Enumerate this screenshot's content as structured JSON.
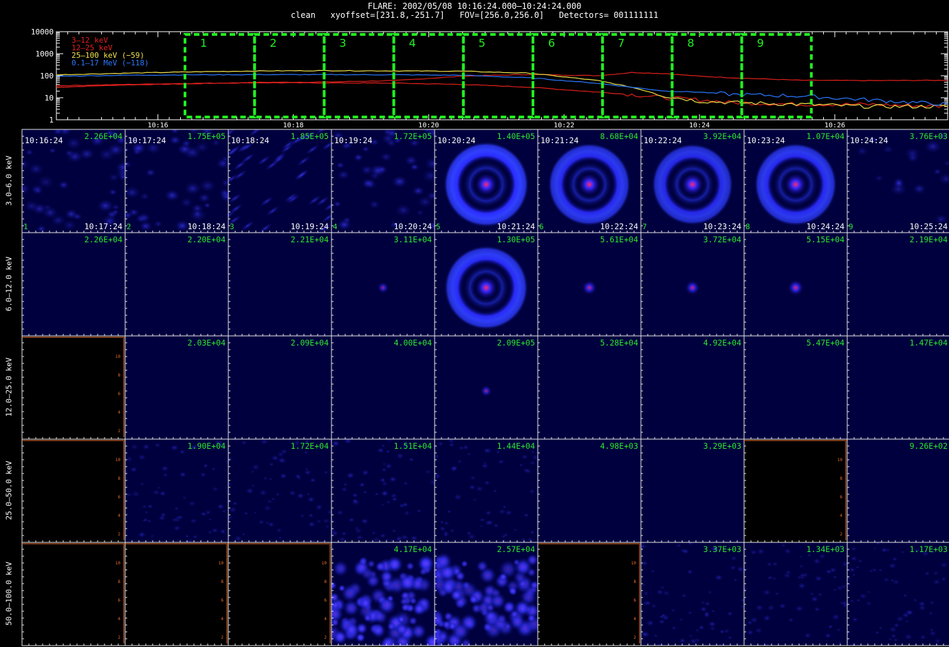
{
  "header": {
    "line1": "FLARE: 2002/05/08 10:16:24.000–10:24:24.000",
    "line2": "clean   xyoffset=[231.8,-251.7]   FOV=[256.0,256.0]   Detectors= 001111111"
  },
  "colors": {
    "band_3_12": "#e0201c",
    "band_12_25": "#e0201c",
    "band_25_100": "#f2e24a",
    "band_100": "#2a78ff",
    "cell_line": "#f07030",
    "value_text": "#2ee82e",
    "window_box": "#22ee22"
  },
  "chart_data": {
    "type": "line",
    "title": "",
    "xlabel": "",
    "ylabel": "",
    "y_scale": "log",
    "ylim": [
      1,
      10000
    ],
    "y_ticks": [
      "1",
      "10",
      "100",
      "1000",
      "10000"
    ],
    "xlim": [
      "10:14:30",
      "10:27:40"
    ],
    "x_ticks": [
      "10:16",
      "10:18",
      "10:20",
      "10:22",
      "10:24",
      "10:26"
    ],
    "legend_position": "top-left",
    "series": [
      {
        "name": "3–12 keV",
        "color": "#e0201c",
        "points": [
          [
            "10:14:30",
            30
          ],
          [
            "10:15:30",
            38
          ],
          [
            "10:16:30",
            43
          ],
          [
            "10:17:30",
            50
          ],
          [
            "10:18:30",
            52
          ],
          [
            "10:19:30",
            60
          ],
          [
            "10:20:30",
            95
          ],
          [
            "10:21:30",
            115
          ],
          [
            "10:22:30",
            100
          ],
          [
            "10:23:00",
            140
          ],
          [
            "10:23:30",
            125
          ],
          [
            "10:24:00",
            95
          ],
          [
            "10:24:30",
            80
          ],
          [
            "10:25:30",
            62
          ],
          [
            "10:26:30",
            60
          ],
          [
            "10:27:40",
            62
          ]
        ]
      },
      {
        "name": "12–25 keV",
        "color": "#e0201c",
        "points": [
          [
            "10:14:30",
            35
          ],
          [
            "10:15:30",
            40
          ],
          [
            "10:16:30",
            45
          ],
          [
            "10:17:30",
            48
          ],
          [
            "10:18:30",
            47
          ],
          [
            "10:19:30",
            46
          ],
          [
            "10:20:30",
            40
          ],
          [
            "10:21:30",
            30
          ],
          [
            "10:22:30",
            18
          ],
          [
            "10:23:00",
            14
          ],
          [
            "10:23:30",
            10
          ],
          [
            "10:24:00",
            8
          ],
          [
            "10:24:30",
            6
          ],
          [
            "10:25:30",
            5
          ],
          [
            "10:26:30",
            5
          ],
          [
            "10:27:40",
            4
          ]
        ]
      },
      {
        "name": "25–100 keV (−59)",
        "color": "#f2e24a",
        "points": [
          [
            "10:14:30",
            110
          ],
          [
            "10:15:30",
            130
          ],
          [
            "10:16:30",
            150
          ],
          [
            "10:17:30",
            165
          ],
          [
            "10:18:30",
            170
          ],
          [
            "10:19:30",
            165
          ],
          [
            "10:20:30",
            160
          ],
          [
            "10:21:30",
            130
          ],
          [
            "10:22:30",
            60
          ],
          [
            "10:23:00",
            30
          ],
          [
            "10:23:30",
            12
          ],
          [
            "10:24:00",
            7
          ],
          [
            "10:24:30",
            6
          ],
          [
            "10:25:30",
            5
          ],
          [
            "10:26:30",
            4
          ],
          [
            "10:27:40",
            4
          ]
        ]
      },
      {
        "name": "0.1–17 MeV (−118)",
        "color": "#2a78ff",
        "points": [
          [
            "10:14:30",
            95
          ],
          [
            "10:15:30",
            105
          ],
          [
            "10:16:30",
            110
          ],
          [
            "10:17:30",
            112
          ],
          [
            "10:18:30",
            112
          ],
          [
            "10:19:30",
            110
          ],
          [
            "10:20:30",
            105
          ],
          [
            "10:21:30",
            80
          ],
          [
            "10:22:30",
            45
          ],
          [
            "10:23:00",
            30
          ],
          [
            "10:23:30",
            20
          ],
          [
            "10:24:00",
            18
          ],
          [
            "10:24:30",
            14
          ],
          [
            "10:25:30",
            12
          ],
          [
            "10:26:30",
            8
          ],
          [
            "10:27:40",
            5
          ]
        ]
      }
    ],
    "windows": [
      {
        "label": "1",
        "start": "10:16:24",
        "end": "10:17:24"
      },
      {
        "label": "2",
        "start": "10:17:24",
        "end": "10:18:24"
      },
      {
        "label": "3",
        "start": "10:18:24",
        "end": "10:19:24"
      },
      {
        "label": "4",
        "start": "10:19:24",
        "end": "10:20:24"
      },
      {
        "label": "5",
        "start": "10:20:24",
        "end": "10:21:24"
      },
      {
        "label": "6",
        "start": "10:21:24",
        "end": "10:22:24"
      },
      {
        "label": "7",
        "start": "10:22:24",
        "end": "10:23:24"
      },
      {
        "label": "8",
        "start": "10:23:24",
        "end": "10:24:24"
      },
      {
        "label": "9",
        "start": "10:24:24",
        "end": "10:25:24"
      }
    ]
  },
  "images": {
    "start_times": [
      "10:16:24",
      "10:17:24",
      "10:18:24",
      "10:19:24",
      "10:20:24",
      "10:21:24",
      "10:22:24",
      "10:23:24",
      "10:24:24"
    ],
    "end_times": [
      "10:17:24",
      "10:18:24",
      "10:19:24",
      "10:20:24",
      "10:21:24",
      "10:22:24",
      "10:23:24",
      "10:24:24",
      "10:25:24"
    ],
    "indices": [
      "1",
      "2",
      "3",
      "4",
      "5",
      "6",
      "7",
      "8",
      "9"
    ],
    "rows": [
      {
        "band": "3.0–6.0 keV",
        "values": [
          "2.26E+04",
          "1.75E+05",
          "1.85E+05",
          "1.72E+05",
          "1.40E+05",
          "8.68E+04",
          "3.92E+04",
          "1.07E+04",
          "3.76E+03"
        ],
        "kind": [
          "noise",
          "blobs",
          "stripes",
          "blobs",
          "ring",
          "ring",
          "ring",
          "ring",
          "faint"
        ],
        "intensity": [
          0.6,
          0.7,
          0.6,
          0.7,
          1.0,
          0.8,
          0.7,
          0.8,
          0.4
        ],
        "empty": [
          false,
          false,
          false,
          false,
          false,
          false,
          false,
          false,
          false
        ]
      },
      {
        "band": "6.0–12.0 keV",
        "values": [
          "2.26E+04",
          "2.20E+04",
          "2.21E+04",
          "3.11E+04",
          "1.30E+05",
          "5.61E+04",
          "3.72E+04",
          "5.15E+04",
          "2.19E+04"
        ],
        "kind": [
          "flat",
          "flat",
          "flat",
          "dot",
          "ring",
          "dot",
          "dot",
          "dot",
          "flat"
        ],
        "intensity": [
          0.1,
          0.1,
          0.1,
          0.4,
          0.9,
          0.7,
          0.7,
          0.8,
          0.1
        ],
        "empty": [
          false,
          false,
          false,
          false,
          false,
          false,
          false,
          false,
          false
        ]
      },
      {
        "band": "12.0–25.0 keV",
        "values": [
          "",
          "2.03E+04",
          "2.09E+04",
          "4.00E+04",
          "2.09E+05",
          "5.28E+04",
          "4.92E+04",
          "5.47E+04",
          "1.47E+04"
        ],
        "kind": [
          "none",
          "flat",
          "flat",
          "flat",
          "dot",
          "flat",
          "flat",
          "flat",
          "flat"
        ],
        "intensity": [
          0,
          0.1,
          0.1,
          0.1,
          0.4,
          0.1,
          0.1,
          0.1,
          0.1
        ],
        "empty": [
          true,
          false,
          false,
          false,
          false,
          false,
          false,
          false,
          false
        ]
      },
      {
        "band": "25.0–50.0 keV",
        "values": [
          "",
          "1.90E+04",
          "1.72E+04",
          "1.51E+04",
          "1.44E+04",
          "4.98E+03",
          "3.29E+03",
          "",
          "9.26E+02"
        ],
        "kind": [
          "none",
          "specks",
          "specks",
          "specks",
          "specks",
          "flat",
          "flat",
          "none",
          "flat"
        ],
        "intensity": [
          0,
          0.4,
          0.4,
          0.5,
          0.3,
          0.1,
          0.1,
          0,
          0.1
        ],
        "empty": [
          true,
          false,
          false,
          false,
          false,
          false,
          false,
          true,
          false
        ]
      },
      {
        "band": "50.0–100.0 keV",
        "values": [
          "",
          "",
          "",
          "4.17E+04",
          "2.57E+04",
          "",
          "3.37E+03",
          "1.34E+03",
          "1.17E+03"
        ],
        "kind": [
          "none",
          "none",
          "none",
          "cloud",
          "cloud",
          "none",
          "specks",
          "specks",
          "specks"
        ],
        "intensity": [
          0,
          0,
          0,
          1.0,
          0.9,
          0,
          0.4,
          0.3,
          0.3
        ],
        "empty": [
          true,
          true,
          true,
          false,
          false,
          true,
          false,
          false,
          false
        ]
      }
    ],
    "empty_axis_ticks": [
      "2",
      "4",
      "6",
      "8",
      "10"
    ]
  }
}
